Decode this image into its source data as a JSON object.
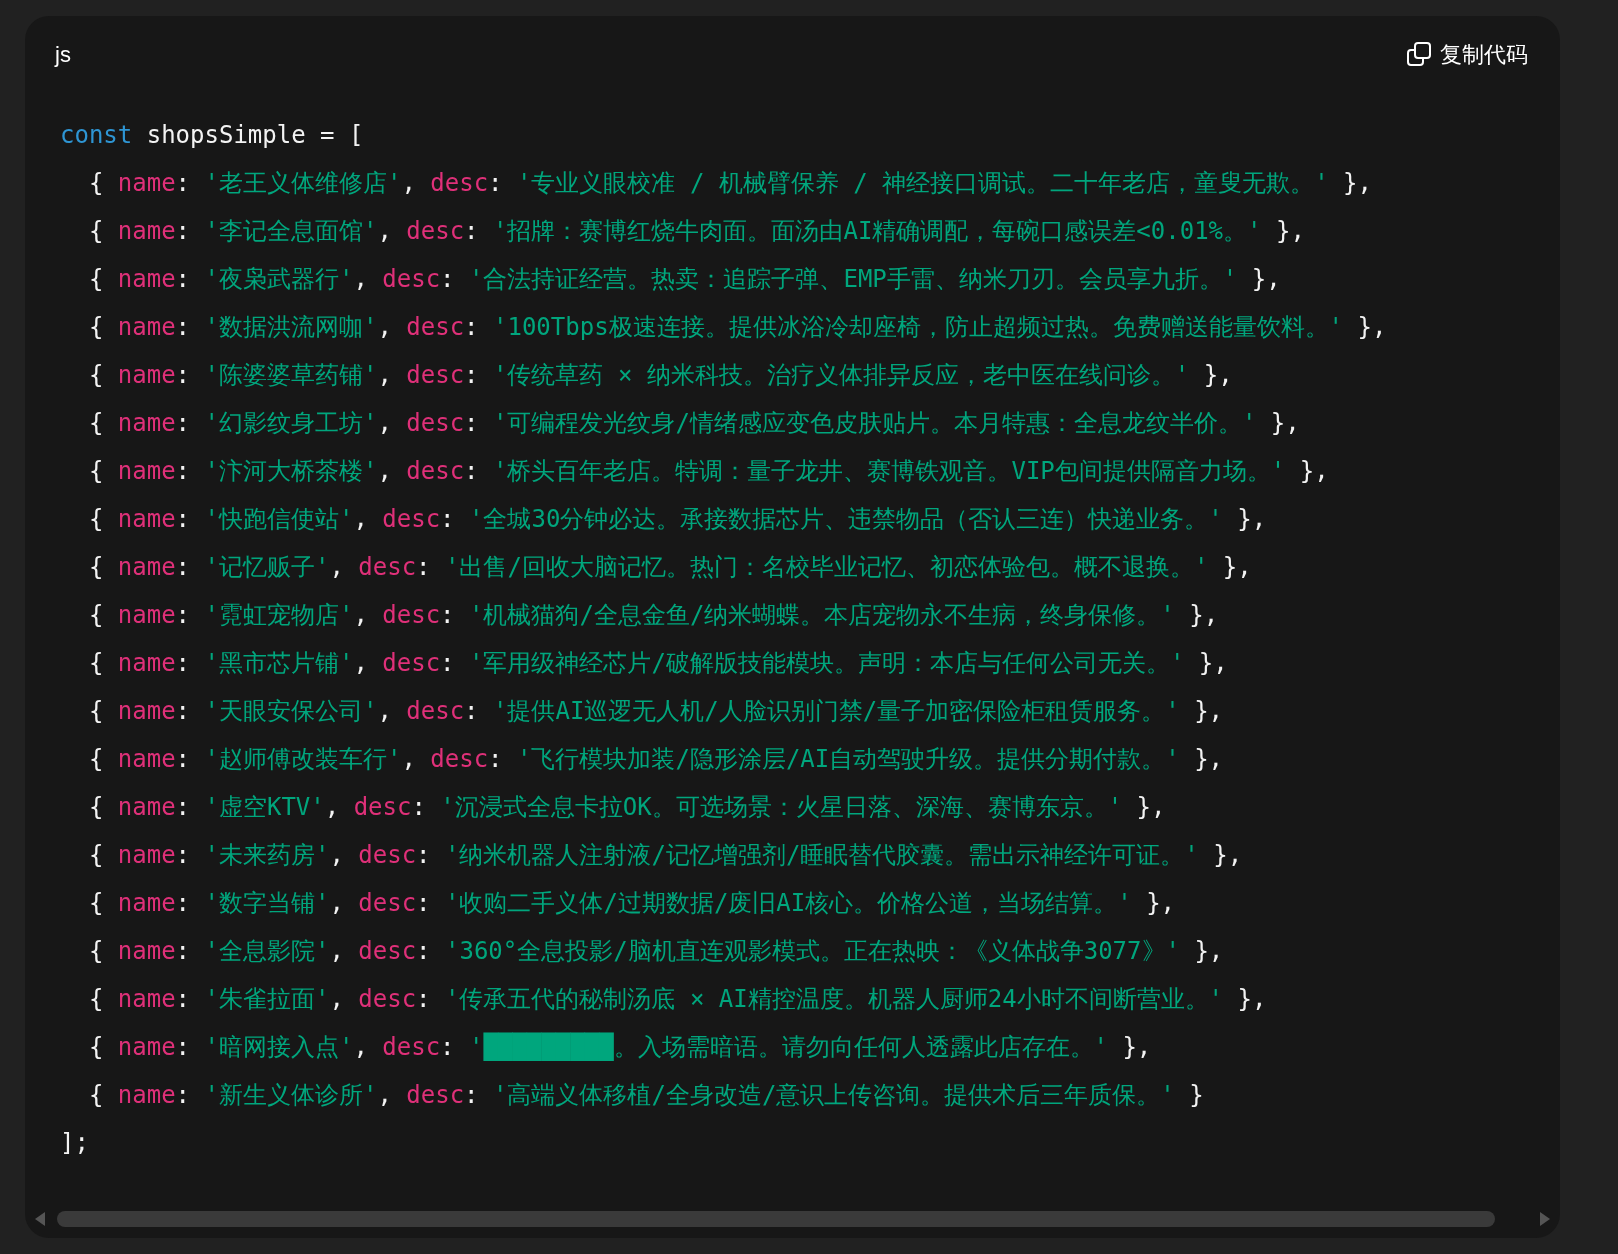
{
  "code_block": {
    "language": "js",
    "copy_button": "复制代码",
    "lines": [
      [
        {
          "kind": "keyword",
          "text": "const"
        },
        {
          "kind": "plain",
          "text": " shopsSimple = ["
        }
      ],
      [
        {
          "kind": "plain",
          "text": "  { "
        },
        {
          "kind": "property",
          "text": "name"
        },
        {
          "kind": "plain",
          "text": ": "
        },
        {
          "kind": "string",
          "text": "'老王义体维修店'"
        },
        {
          "kind": "plain",
          "text": ", "
        },
        {
          "kind": "property",
          "text": "desc"
        },
        {
          "kind": "plain",
          "text": ": "
        },
        {
          "kind": "string",
          "text": "'专业义眼校准 / 机械臂保养 / 神经接口调试。二十年老店，童叟无欺。'"
        },
        {
          "kind": "plain",
          "text": " },"
        }
      ],
      [
        {
          "kind": "plain",
          "text": "  { "
        },
        {
          "kind": "property",
          "text": "name"
        },
        {
          "kind": "plain",
          "text": ": "
        },
        {
          "kind": "string",
          "text": "'李记全息面馆'"
        },
        {
          "kind": "plain",
          "text": ", "
        },
        {
          "kind": "property",
          "text": "desc"
        },
        {
          "kind": "plain",
          "text": ": "
        },
        {
          "kind": "string",
          "text": "'招牌：赛博红烧牛肉面。面汤由AI精确调配，每碗口感误差<0.01%。'"
        },
        {
          "kind": "plain",
          "text": " },"
        }
      ],
      [
        {
          "kind": "plain",
          "text": "  { "
        },
        {
          "kind": "property",
          "text": "name"
        },
        {
          "kind": "plain",
          "text": ": "
        },
        {
          "kind": "string",
          "text": "'夜枭武器行'"
        },
        {
          "kind": "plain",
          "text": ", "
        },
        {
          "kind": "property",
          "text": "desc"
        },
        {
          "kind": "plain",
          "text": ": "
        },
        {
          "kind": "string",
          "text": "'合法持证经营。热卖：追踪子弹、EMP手雷、纳米刀刃。会员享九折。'"
        },
        {
          "kind": "plain",
          "text": " },"
        }
      ],
      [
        {
          "kind": "plain",
          "text": "  { "
        },
        {
          "kind": "property",
          "text": "name"
        },
        {
          "kind": "plain",
          "text": ": "
        },
        {
          "kind": "string",
          "text": "'数据洪流网咖'"
        },
        {
          "kind": "plain",
          "text": ", "
        },
        {
          "kind": "property",
          "text": "desc"
        },
        {
          "kind": "plain",
          "text": ": "
        },
        {
          "kind": "string",
          "text": "'100Tbps极速连接。提供冰浴冷却座椅，防止超频过热。免费赠送能量饮料。'"
        },
        {
          "kind": "plain",
          "text": " },"
        }
      ],
      [
        {
          "kind": "plain",
          "text": "  { "
        },
        {
          "kind": "property",
          "text": "name"
        },
        {
          "kind": "plain",
          "text": ": "
        },
        {
          "kind": "string",
          "text": "'陈婆婆草药铺'"
        },
        {
          "kind": "plain",
          "text": ", "
        },
        {
          "kind": "property",
          "text": "desc"
        },
        {
          "kind": "plain",
          "text": ": "
        },
        {
          "kind": "string",
          "text": "'传统草药 × 纳米科技。治疗义体排异反应，老中医在线问诊。'"
        },
        {
          "kind": "plain",
          "text": " },"
        }
      ],
      [
        {
          "kind": "plain",
          "text": "  { "
        },
        {
          "kind": "property",
          "text": "name"
        },
        {
          "kind": "plain",
          "text": ": "
        },
        {
          "kind": "string",
          "text": "'幻影纹身工坊'"
        },
        {
          "kind": "plain",
          "text": ", "
        },
        {
          "kind": "property",
          "text": "desc"
        },
        {
          "kind": "plain",
          "text": ": "
        },
        {
          "kind": "string",
          "text": "'可编程发光纹身/情绪感应变色皮肤贴片。本月特惠：全息龙纹半价。'"
        },
        {
          "kind": "plain",
          "text": " },"
        }
      ],
      [
        {
          "kind": "plain",
          "text": "  { "
        },
        {
          "kind": "property",
          "text": "name"
        },
        {
          "kind": "plain",
          "text": ": "
        },
        {
          "kind": "string",
          "text": "'汴河大桥茶楼'"
        },
        {
          "kind": "plain",
          "text": ", "
        },
        {
          "kind": "property",
          "text": "desc"
        },
        {
          "kind": "plain",
          "text": ": "
        },
        {
          "kind": "string",
          "text": "'桥头百年老店。特调：量子龙井、赛博铁观音。VIP包间提供隔音力场。'"
        },
        {
          "kind": "plain",
          "text": " },"
        }
      ],
      [
        {
          "kind": "plain",
          "text": "  { "
        },
        {
          "kind": "property",
          "text": "name"
        },
        {
          "kind": "plain",
          "text": ": "
        },
        {
          "kind": "string",
          "text": "'快跑信使站'"
        },
        {
          "kind": "plain",
          "text": ", "
        },
        {
          "kind": "property",
          "text": "desc"
        },
        {
          "kind": "plain",
          "text": ": "
        },
        {
          "kind": "string",
          "text": "'全城30分钟必达。承接数据芯片、违禁物品（否认三连）快递业务。'"
        },
        {
          "kind": "plain",
          "text": " },"
        }
      ],
      [
        {
          "kind": "plain",
          "text": "  { "
        },
        {
          "kind": "property",
          "text": "name"
        },
        {
          "kind": "plain",
          "text": ": "
        },
        {
          "kind": "string",
          "text": "'记忆贩子'"
        },
        {
          "kind": "plain",
          "text": ", "
        },
        {
          "kind": "property",
          "text": "desc"
        },
        {
          "kind": "plain",
          "text": ": "
        },
        {
          "kind": "string",
          "text": "'出售/回收大脑记忆。热门：名校毕业记忆、初恋体验包。概不退换。'"
        },
        {
          "kind": "plain",
          "text": " },"
        }
      ],
      [
        {
          "kind": "plain",
          "text": "  { "
        },
        {
          "kind": "property",
          "text": "name"
        },
        {
          "kind": "plain",
          "text": ": "
        },
        {
          "kind": "string",
          "text": "'霓虹宠物店'"
        },
        {
          "kind": "plain",
          "text": ", "
        },
        {
          "kind": "property",
          "text": "desc"
        },
        {
          "kind": "plain",
          "text": ": "
        },
        {
          "kind": "string",
          "text": "'机械猫狗/全息金鱼/纳米蝴蝶。本店宠物永不生病，终身保修。'"
        },
        {
          "kind": "plain",
          "text": " },"
        }
      ],
      [
        {
          "kind": "plain",
          "text": "  { "
        },
        {
          "kind": "property",
          "text": "name"
        },
        {
          "kind": "plain",
          "text": ": "
        },
        {
          "kind": "string",
          "text": "'黑市芯片铺'"
        },
        {
          "kind": "plain",
          "text": ", "
        },
        {
          "kind": "property",
          "text": "desc"
        },
        {
          "kind": "plain",
          "text": ": "
        },
        {
          "kind": "string",
          "text": "'军用级神经芯片/破解版技能模块。声明：本店与任何公司无关。'"
        },
        {
          "kind": "plain",
          "text": " },"
        }
      ],
      [
        {
          "kind": "plain",
          "text": "  { "
        },
        {
          "kind": "property",
          "text": "name"
        },
        {
          "kind": "plain",
          "text": ": "
        },
        {
          "kind": "string",
          "text": "'天眼安保公司'"
        },
        {
          "kind": "plain",
          "text": ", "
        },
        {
          "kind": "property",
          "text": "desc"
        },
        {
          "kind": "plain",
          "text": ": "
        },
        {
          "kind": "string",
          "text": "'提供AI巡逻无人机/人脸识别门禁/量子加密保险柜租赁服务。'"
        },
        {
          "kind": "plain",
          "text": " },"
        }
      ],
      [
        {
          "kind": "plain",
          "text": "  { "
        },
        {
          "kind": "property",
          "text": "name"
        },
        {
          "kind": "plain",
          "text": ": "
        },
        {
          "kind": "string",
          "text": "'赵师傅改装车行'"
        },
        {
          "kind": "plain",
          "text": ", "
        },
        {
          "kind": "property",
          "text": "desc"
        },
        {
          "kind": "plain",
          "text": ": "
        },
        {
          "kind": "string",
          "text": "'飞行模块加装/隐形涂层/AI自动驾驶升级。提供分期付款。'"
        },
        {
          "kind": "plain",
          "text": " },"
        }
      ],
      [
        {
          "kind": "plain",
          "text": "  { "
        },
        {
          "kind": "property",
          "text": "name"
        },
        {
          "kind": "plain",
          "text": ": "
        },
        {
          "kind": "string",
          "text": "'虚空KTV'"
        },
        {
          "kind": "plain",
          "text": ", "
        },
        {
          "kind": "property",
          "text": "desc"
        },
        {
          "kind": "plain",
          "text": ": "
        },
        {
          "kind": "string",
          "text": "'沉浸式全息卡拉OK。可选场景：火星日落、深海、赛博东京。'"
        },
        {
          "kind": "plain",
          "text": " },"
        }
      ],
      [
        {
          "kind": "plain",
          "text": "  { "
        },
        {
          "kind": "property",
          "text": "name"
        },
        {
          "kind": "plain",
          "text": ": "
        },
        {
          "kind": "string",
          "text": "'未来药房'"
        },
        {
          "kind": "plain",
          "text": ", "
        },
        {
          "kind": "property",
          "text": "desc"
        },
        {
          "kind": "plain",
          "text": ": "
        },
        {
          "kind": "string",
          "text": "'纳米机器人注射液/记忆增强剂/睡眠替代胶囊。需出示神经许可证。'"
        },
        {
          "kind": "plain",
          "text": " },"
        }
      ],
      [
        {
          "kind": "plain",
          "text": "  { "
        },
        {
          "kind": "property",
          "text": "name"
        },
        {
          "kind": "plain",
          "text": ": "
        },
        {
          "kind": "string",
          "text": "'数字当铺'"
        },
        {
          "kind": "plain",
          "text": ", "
        },
        {
          "kind": "property",
          "text": "desc"
        },
        {
          "kind": "plain",
          "text": ": "
        },
        {
          "kind": "string",
          "text": "'收购二手义体/过期数据/废旧AI核心。价格公道，当场结算。'"
        },
        {
          "kind": "plain",
          "text": " },"
        }
      ],
      [
        {
          "kind": "plain",
          "text": "  { "
        },
        {
          "kind": "property",
          "text": "name"
        },
        {
          "kind": "plain",
          "text": ": "
        },
        {
          "kind": "string",
          "text": "'全息影院'"
        },
        {
          "kind": "plain",
          "text": ", "
        },
        {
          "kind": "property",
          "text": "desc"
        },
        {
          "kind": "plain",
          "text": ": "
        },
        {
          "kind": "string",
          "text": "'360°全息投影/脑机直连观影模式。正在热映：《义体战争3077》'"
        },
        {
          "kind": "plain",
          "text": " },"
        }
      ],
      [
        {
          "kind": "plain",
          "text": "  { "
        },
        {
          "kind": "property",
          "text": "name"
        },
        {
          "kind": "plain",
          "text": ": "
        },
        {
          "kind": "string",
          "text": "'朱雀拉面'"
        },
        {
          "kind": "plain",
          "text": ", "
        },
        {
          "kind": "property",
          "text": "desc"
        },
        {
          "kind": "plain",
          "text": ": "
        },
        {
          "kind": "string",
          "text": "'传承五代的秘制汤底 × AI精控温度。机器人厨师24小时不间断营业。'"
        },
        {
          "kind": "plain",
          "text": " },"
        }
      ],
      [
        {
          "kind": "plain",
          "text": "  { "
        },
        {
          "kind": "property",
          "text": "name"
        },
        {
          "kind": "plain",
          "text": ": "
        },
        {
          "kind": "string",
          "text": "'暗网接入点'"
        },
        {
          "kind": "plain",
          "text": ", "
        },
        {
          "kind": "property",
          "text": "desc"
        },
        {
          "kind": "plain",
          "text": ": "
        },
        {
          "kind": "string",
          "text": "'█████████。入场需暗语。请勿向任何人透露此店存在。'"
        },
        {
          "kind": "plain",
          "text": " },"
        }
      ],
      [
        {
          "kind": "plain",
          "text": "  { "
        },
        {
          "kind": "property",
          "text": "name"
        },
        {
          "kind": "plain",
          "text": ": "
        },
        {
          "kind": "string",
          "text": "'新生义体诊所'"
        },
        {
          "kind": "plain",
          "text": ", "
        },
        {
          "kind": "property",
          "text": "desc"
        },
        {
          "kind": "plain",
          "text": ": "
        },
        {
          "kind": "string",
          "text": "'高端义体移植/全身改造/意识上传咨询。提供术后三年质保。'"
        },
        {
          "kind": "plain",
          "text": " }"
        }
      ],
      [
        {
          "kind": "plain",
          "text": "];"
        }
      ]
    ]
  }
}
